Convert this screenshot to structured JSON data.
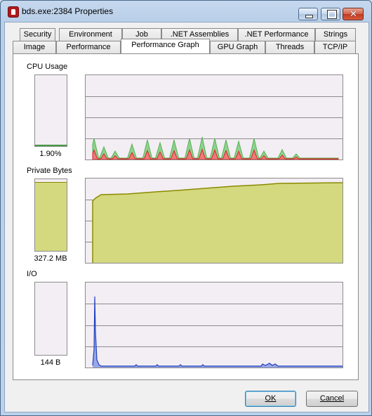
{
  "window": {
    "title": "bds.exe:2384 Properties"
  },
  "tabs_top": [
    {
      "label": "Security"
    },
    {
      "label": "Environment"
    },
    {
      "label": "Job"
    },
    {
      "label": ".NET Assemblies"
    },
    {
      "label": ".NET Performance"
    },
    {
      "label": "Strings"
    }
  ],
  "tabs_bottom": [
    {
      "label": "Image"
    },
    {
      "label": "Performance"
    },
    {
      "label": "Performance Graph"
    },
    {
      "label": "GPU Graph"
    },
    {
      "label": "Threads"
    },
    {
      "label": "TCP/IP"
    }
  ],
  "active_tab": "Performance Graph",
  "sections": {
    "cpu": {
      "label": "CPU Usage",
      "value": "1.90%",
      "level": 0.019
    },
    "private_bytes": {
      "label": "Private Bytes",
      "value": "327.2 MB",
      "level": 0.96
    },
    "io": {
      "label": "I/O",
      "value": "144 B",
      "level": 0.0
    }
  },
  "buttons": {
    "ok": "OK",
    "cancel": "Cancel"
  },
  "colors": {
    "graph_bg": "#f3eef3",
    "cpu_kernel": "#d92626",
    "cpu_total": "#56b356",
    "memory_fill": "#d4d97f",
    "memory_line": "#8a8a00",
    "io_line": "#1f3fbf"
  }
}
